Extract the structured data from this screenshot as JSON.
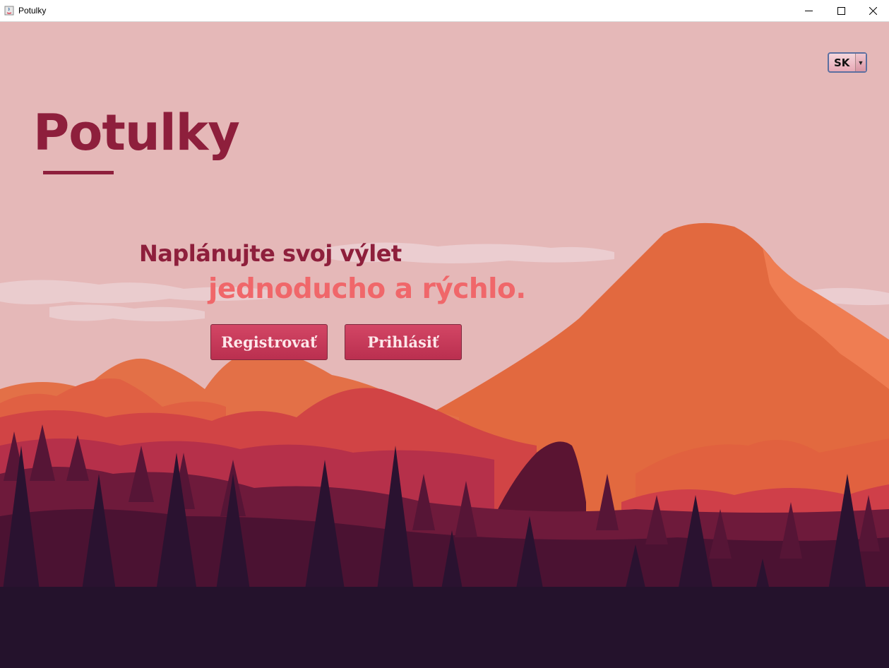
{
  "window": {
    "title": "Potulky",
    "icons": [
      "java-icon",
      "minimize-icon",
      "maximize-icon",
      "close-icon"
    ]
  },
  "language": {
    "selected": "SK",
    "icon": "chevron-down-icon"
  },
  "logo": {
    "text": "Potulky"
  },
  "tagline": {
    "line1": "Naplánujte svoj výlet",
    "line2": "jednoducho a rýchlo."
  },
  "buttons": {
    "register": "Registrovať",
    "login": "Prihlásiť"
  },
  "colors": {
    "brand": "#8e1f3c",
    "accent": "#f0676a",
    "button": "#c63b5b",
    "sky": "#e5b8b8"
  }
}
